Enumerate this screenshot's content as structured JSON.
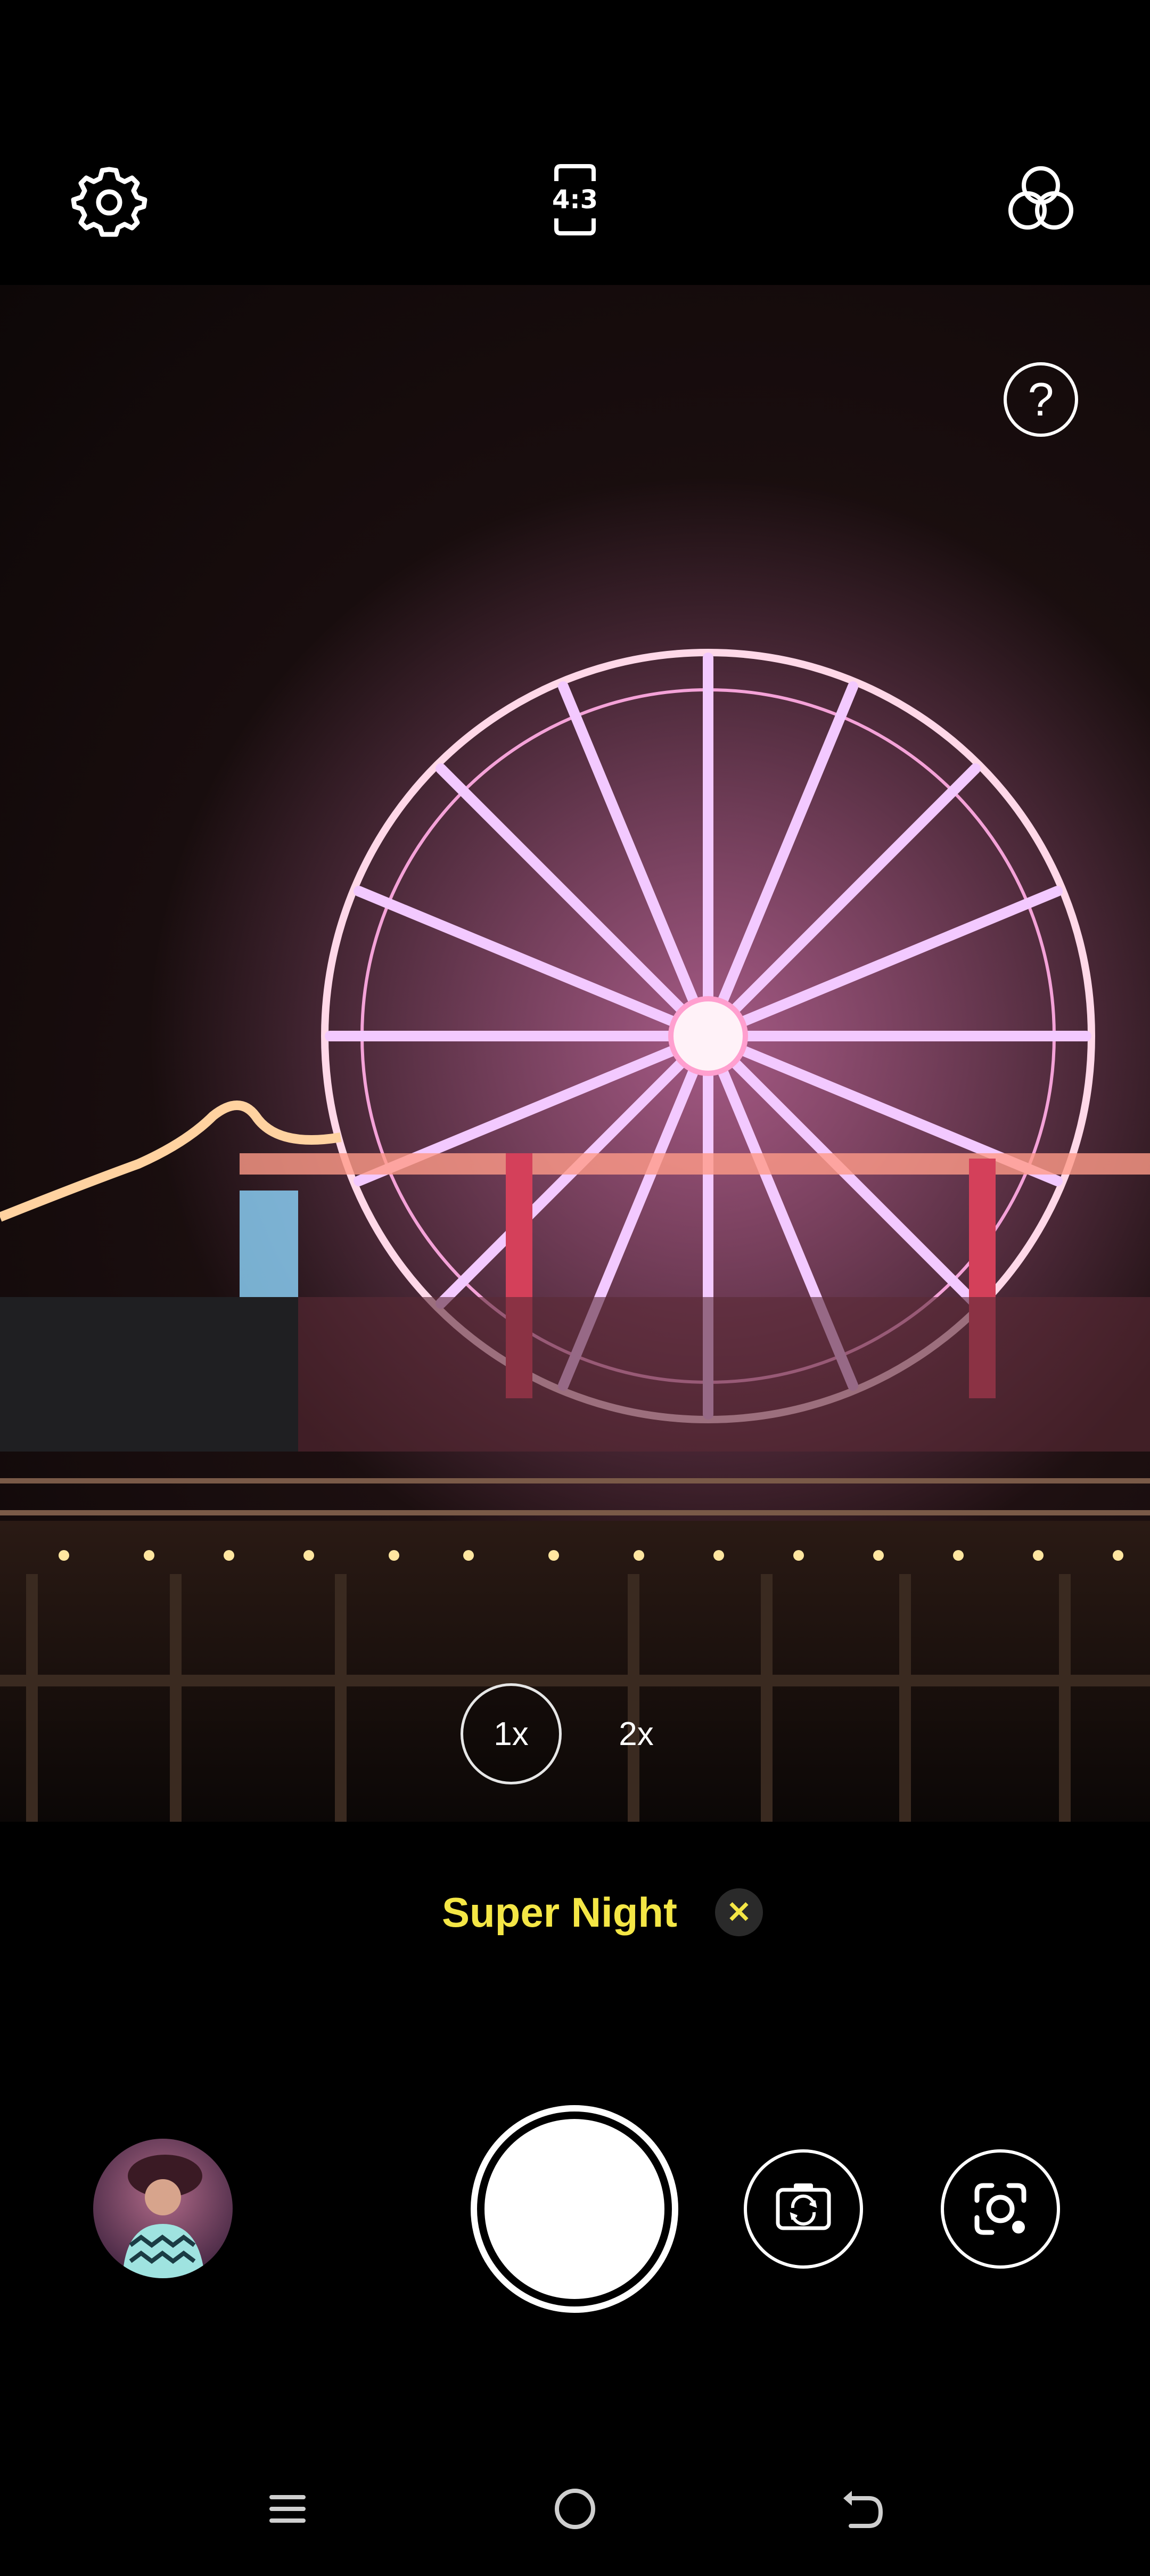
{
  "top_bar": {
    "aspect_ratio": "4:3",
    "icons": [
      "gear-icon",
      "aspect-ratio-icon",
      "filters-icon"
    ]
  },
  "viewfinder": {
    "help_label": "?",
    "zoom": {
      "selected": "1x",
      "options": [
        "1x",
        "2x"
      ]
    }
  },
  "mode": {
    "label": "Super Night",
    "close_label": "✕",
    "color": "#f4e645"
  },
  "nav": {
    "icons": [
      "menu-icon",
      "home-icon",
      "back-icon"
    ]
  }
}
